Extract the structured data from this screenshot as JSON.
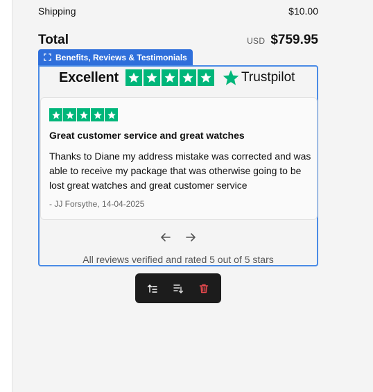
{
  "summary": {
    "shipping_label": "Shipping",
    "shipping_value": "$10.00",
    "total_label": "Total",
    "total_currency": "USD",
    "total_value": "$759.95"
  },
  "block": {
    "tag_label": "Benefits, Reviews & Testimonials",
    "tag_icon": "select-frame-icon",
    "rating_word": "Excellent",
    "brand": "Trustpilot",
    "colors": {
      "selection": "#2f6fdb",
      "trustpilot_green": "#00b67a"
    }
  },
  "review": {
    "stars": 5,
    "title": "Great customer service and great watches",
    "body": "Thanks to Diane my address mistake was corrected and was able to receive my package that was otherwise going to be lost great watches and great customer service",
    "author": "- JJ Forsythe, 14-04-2025"
  },
  "footer_note": "All reviews verified and rated 5 out of 5 stars",
  "toolbar": {
    "icons": [
      "move-up-icon",
      "move-down-icon",
      "trash-icon"
    ],
    "delete_color": "#e5484d"
  }
}
